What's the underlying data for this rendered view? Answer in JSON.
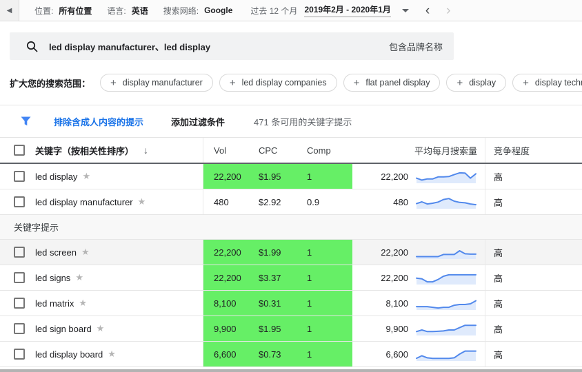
{
  "toolbar": {
    "location_label": "位置:",
    "location_value": "所有位置",
    "language_label": "语言:",
    "language_value": "英语",
    "network_label": "搜索网络:",
    "network_value": "Google",
    "period_label": "过去 12 个月",
    "period_value": "2019年2月 - 2020年1月"
  },
  "search": {
    "query": "led display manufacturer、led display",
    "brand_label": "包含品牌名称"
  },
  "broaden": {
    "label": "扩大您的搜索范围：",
    "chips": [
      "display manufacturer",
      "led display companies",
      "flat panel display",
      "display",
      "display technology",
      ""
    ]
  },
  "filter_bar": {
    "exclude_adult": "排除含成人内容的提示",
    "add_filter": "添加过滤条件",
    "available": "471 条可用的关键字提示"
  },
  "table": {
    "headers": {
      "keyword": "关键字（按相关性排序）",
      "vol": "Vol",
      "cpc": "CPC",
      "comp": "Comp",
      "avg_monthly": "平均每月搜索量",
      "competition": "竞争程度"
    },
    "section_label": "关键字提示",
    "selected_rows": [
      {
        "keyword": "led display",
        "vol": "22,200",
        "cpc": "$1.95",
        "comp": "1",
        "avg": "22,200",
        "competition": "高",
        "highlight": true,
        "shaded": false,
        "trend": [
          35,
          18,
          28,
          28,
          45,
          45,
          48,
          65,
          80,
          78,
          35,
          72
        ]
      },
      {
        "keyword": "led display manufacturer",
        "vol": "480",
        "cpc": "$2.92",
        "comp": "0.9",
        "avg": "480",
        "competition": "高",
        "highlight": false,
        "shaded": false,
        "trend": [
          35,
          50,
          32,
          38,
          48,
          70,
          78,
          56,
          45,
          42,
          32,
          26
        ]
      }
    ],
    "suggestion_rows": [
      {
        "keyword": "led screen",
        "vol": "22,200",
        "cpc": "$1.99",
        "comp": "1",
        "avg": "22,200",
        "competition": "高",
        "highlight": true,
        "shaded": true,
        "trend": [
          12,
          12,
          12,
          12,
          12,
          30,
          30,
          30,
          62,
          36,
          33,
          33
        ]
      },
      {
        "keyword": "led signs",
        "vol": "22,200",
        "cpc": "$3.37",
        "comp": "1",
        "avg": "22,200",
        "competition": "高",
        "highlight": true,
        "shaded": false,
        "trend": [
          45,
          40,
          14,
          14,
          34,
          62,
          74,
          74,
          74,
          74,
          74,
          74
        ]
      },
      {
        "keyword": "led matrix",
        "vol": "8,100",
        "cpc": "$0.31",
        "comp": "1",
        "avg": "8,100",
        "competition": "高",
        "highlight": true,
        "shaded": false,
        "trend": [
          20,
          20,
          20,
          14,
          8,
          14,
          14,
          32,
          38,
          38,
          44,
          70
        ]
      },
      {
        "keyword": "led sign board",
        "vol": "9,900",
        "cpc": "$1.95",
        "comp": "1",
        "avg": "9,900",
        "competition": "高",
        "highlight": true,
        "shaded": false,
        "trend": [
          25,
          38,
          25,
          25,
          27,
          30,
          38,
          38,
          58,
          78,
          78,
          78
        ]
      },
      {
        "keyword": "led display board",
        "vol": "6,600",
        "cpc": "$0.73",
        "comp": "1",
        "avg": "6,600",
        "competition": "高",
        "highlight": true,
        "shaded": false,
        "trend": [
          14,
          36,
          18,
          13,
          13,
          13,
          13,
          18,
          50,
          76,
          76,
          76
        ]
      }
    ]
  },
  "colors": {
    "highlight_green": "#66ef66",
    "link_blue": "#1a73e8",
    "icon_blue": "#4285f4",
    "spark_line": "#5289ec",
    "spark_fill": "#dfeafc"
  }
}
